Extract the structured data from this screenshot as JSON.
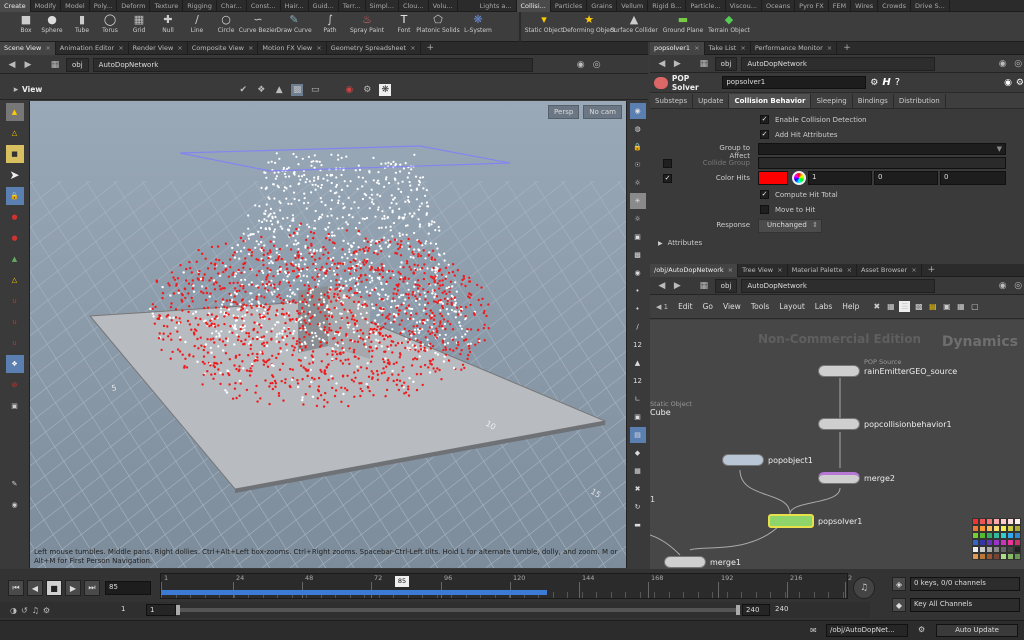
{
  "shelf": {
    "left_tabs": [
      "Create",
      "Modify",
      "Model",
      "Poly...",
      "Deform",
      "Texture",
      "Rigging",
      "Char...",
      "Const...",
      "Hair...",
      "Guid...",
      "Terr...",
      "Simpl...",
      "Clou...",
      "Volu..."
    ],
    "right_tabs": [
      "Lights a...",
      "Collisi...",
      "Particles",
      "Grains",
      "Vellum",
      "Rigid B...",
      "Particle...",
      "Viscou...",
      "Oceans",
      "Pyro FX",
      "FEM",
      "Wires",
      "Crowds",
      "Drive S..."
    ],
    "left_tools": [
      "Box",
      "Sphere",
      "Tube",
      "Torus",
      "Grid",
      "Null",
      "Line",
      "Circle",
      "Curve Bezier",
      "Draw Curve",
      "Path",
      "Spray Paint",
      "Font",
      "Platonic Solids",
      "L-System"
    ],
    "right_tools": [
      "Static Object",
      "Deforming Object",
      "Surface Collider",
      "Ground Plane",
      "Terrain Object"
    ]
  },
  "left_pane": {
    "tabs": [
      "Scene View",
      "Animation Editor",
      "Render View",
      "Composite View",
      "Motion FX View",
      "Geometry Spreadsheet"
    ],
    "path_root": "obj",
    "path_node": "AutoDopNetwork",
    "view_label": "View",
    "persp_label": "Persp",
    "cam_label": "No cam",
    "hint": "Left mouse tumbles. Middle pans. Right dollies. Ctrl+Alt+Left box-zooms. Ctrl+Right zooms. Spacebar-Ctrl-Left tilts. Hold L for alternate tumble, dolly, and zoom.    M or Alt+M for First Person Navigation.",
    "ruler_labels": [
      "5",
      "10",
      "15"
    ]
  },
  "param_pane": {
    "tabs": [
      "popsolver1",
      "Take List",
      "Performance Monitor"
    ],
    "path_root": "obj",
    "path_node": "AutoDopNetwork",
    "node_type": "POP Solver",
    "node_name": "popsolver1",
    "subtabs": [
      "Substeps",
      "Update",
      "Collision Behavior",
      "Sleeping",
      "Bindings",
      "Distribution"
    ],
    "enable_collision": "Enable Collision Detection",
    "add_hit": "Add Hit Attributes",
    "group_to_affect": "Group to Affect",
    "collide_group": "Collide Group",
    "color_hits": "Color Hits",
    "color_values": [
      "1",
      "0",
      "0"
    ],
    "hit_color": "#ff0000",
    "compute_hit": "Compute Hit Total",
    "move_to_hit": "Move to Hit",
    "response_label": "Response",
    "response_value": "Unchanged",
    "attributes": "Attributes"
  },
  "network_pane": {
    "tabs": [
      "/obj/AutoDopNetwork",
      "Tree View",
      "Material Palette",
      "Asset Browser"
    ],
    "path_root": "obj",
    "path_node": "AutoDopNetwork",
    "menus": [
      "Edit",
      "Go",
      "View",
      "Tools",
      "Layout",
      "Labs",
      "Help"
    ],
    "watermark": "Non-Commercial Edition",
    "context": "Dynamics",
    "frame_marker": "1",
    "nodes": [
      {
        "name": "rainEmitterGEO_source",
        "type": "POP Source"
      },
      {
        "name": "popcollisionbehavior1",
        "type": ""
      },
      {
        "name": "popobject1",
        "type": ""
      },
      {
        "name": "merge2",
        "type": ""
      },
      {
        "name": "popsolver1",
        "type": ""
      },
      {
        "name": "merge1",
        "type": ""
      },
      {
        "name": "Cube",
        "type": "Static Object"
      }
    ]
  },
  "timeline": {
    "current_frame": "85",
    "start_frame": "1",
    "range_start": "1",
    "range_end": "240",
    "end_frame": "240",
    "ticks": [
      "1",
      "24",
      "48",
      "72",
      "96",
      "120",
      "144",
      "168",
      "192",
      "216",
      "2"
    ],
    "keys_status": "0 keys, 0/0 channels",
    "key_channels": "Key All Channels",
    "status_path": "/obj/AutoDopNet...",
    "update_mode": "Auto Update"
  }
}
